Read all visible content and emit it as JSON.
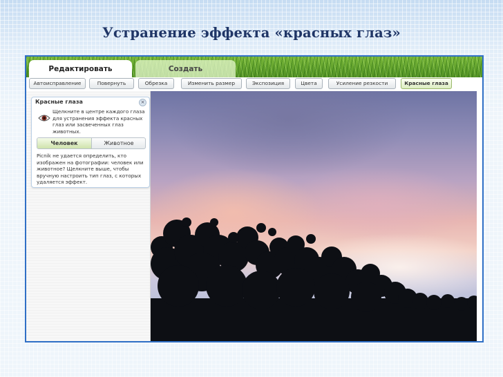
{
  "slide": {
    "title": "Устранение эффекта «красных глаз»"
  },
  "tabs": [
    {
      "label": "Редактировать"
    },
    {
      "label": "Создать"
    }
  ],
  "toolbar": {
    "buttons": [
      "Автоисправление",
      "Повернуть",
      "Обрезка",
      "Изменить размер",
      "Экспозиция",
      "Цвета",
      "Усиление резкости",
      "Красные глаза"
    ]
  },
  "panel": {
    "title": "Красные глаза",
    "close": "×",
    "help": "Щелкните в центре каждого глаза для устранения эффекта красных глаз или засвеченных глаз животных.",
    "segment": {
      "human": "Человек",
      "animal": "Животное"
    },
    "note": "Picnik не удается определить, кто изображен на фотографии: человек или животное? Щелкните выше, чтобы вручную настроить тип глаз, с которых удаляется эффект."
  },
  "colors": {
    "title": "#1f3566",
    "frame": "#2f6fc6",
    "active_tool": "#dcedc1"
  },
  "icons": {
    "eye": "eye-icon",
    "close": "close-icon"
  }
}
